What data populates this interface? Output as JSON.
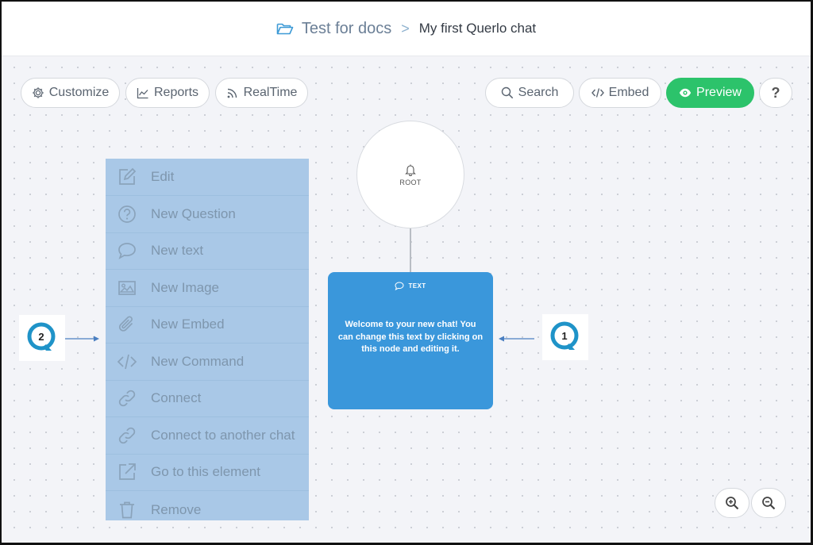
{
  "breadcrumb": {
    "folder_icon": "folder-open-icon",
    "folder": "Test for docs",
    "separator": ">",
    "page": "My first Querlo chat"
  },
  "toolbar": {
    "customize": "Customize",
    "reports": "Reports",
    "realtime": "RealTime",
    "search": "Search",
    "embed": "Embed",
    "preview": "Preview",
    "help": "?"
  },
  "colors": {
    "preview_green": "#2cc36b",
    "node_blue": "#3a97db",
    "menu_blue": "#a9c8e7",
    "badge_teal": "#1f93c8"
  },
  "root_node": {
    "label": "ROOT",
    "icon": "bell-icon"
  },
  "text_node": {
    "type_label": "TEXT",
    "icon": "speech-bubble-icon",
    "message": "Welcome to your new chat! You can change this text by clicking on this node and editing it."
  },
  "context_menu": {
    "items": [
      {
        "label": "Edit",
        "icon": "edit-icon"
      },
      {
        "label": "New Question",
        "icon": "question-circle-icon"
      },
      {
        "label": "New text",
        "icon": "speech-bubble-icon"
      },
      {
        "label": "New Image",
        "icon": "image-icon"
      },
      {
        "label": "New Embed",
        "icon": "paperclip-icon"
      },
      {
        "label": "New Command",
        "icon": "code-icon"
      },
      {
        "label": "Connect",
        "icon": "link-icon"
      },
      {
        "label": "Connect to another chat",
        "icon": "link-icon"
      },
      {
        "label": "Go to this element",
        "icon": "external-link-icon"
      },
      {
        "label": "Remove",
        "icon": "trash-icon"
      }
    ]
  },
  "annotations": [
    {
      "number": "1"
    },
    {
      "number": "2"
    }
  ],
  "zoom": {
    "in_icon": "zoom-in-icon",
    "out_icon": "zoom-out-icon"
  }
}
